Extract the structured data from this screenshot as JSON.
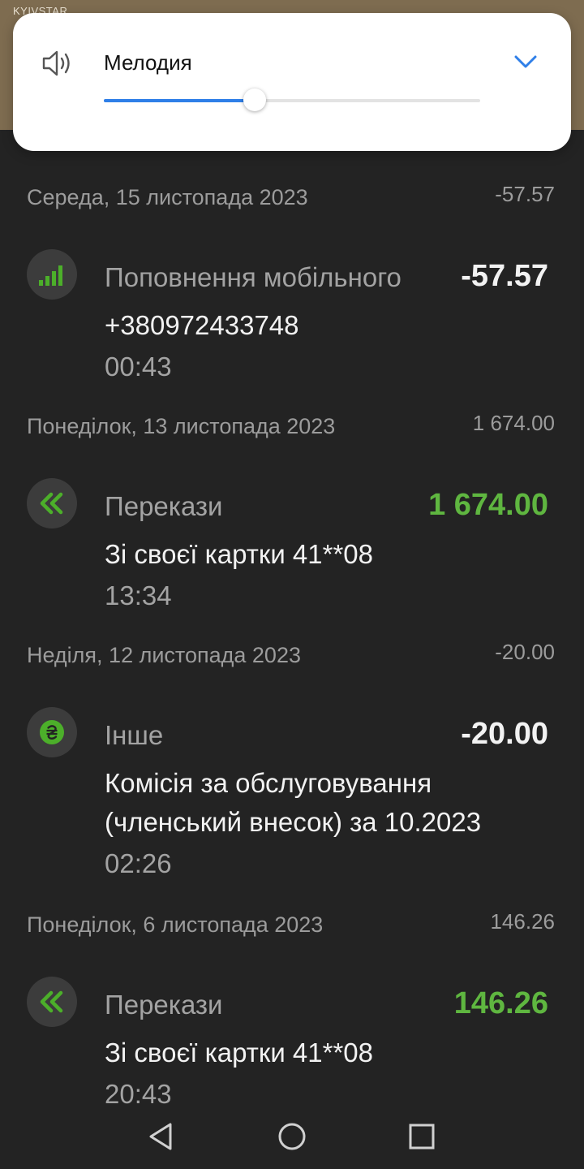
{
  "status_bar": {
    "carrier": "KYIVSTAR"
  },
  "volume": {
    "label": "Мелодия",
    "level": 0.4,
    "accent": "#2f7fe8",
    "icons": {
      "speaker": "speaker-icon",
      "expand": "chevron-down-icon"
    }
  },
  "groups": [
    {
      "date": "Середа, 15 листопада 2023",
      "total": "-57.57",
      "items": [
        {
          "icon": "mobile-signal-icon",
          "category": "Поповнення мобільного",
          "amount": "-57.57",
          "positive": false,
          "description": "+380972433748",
          "time": "00:43"
        }
      ]
    },
    {
      "date": "Понеділок, 13 листопада 2023",
      "total": "1 674.00",
      "items": [
        {
          "icon": "transfer-arrows-icon",
          "category": "Перекази",
          "amount": "1 674.00",
          "positive": true,
          "description": "Зі своєї картки 41**08",
          "time": "13:34"
        }
      ]
    },
    {
      "date": "Неділя, 12 листопада 2023",
      "total": "-20.00",
      "items": [
        {
          "icon": "hryvnia-coin-icon",
          "category": "Інше",
          "amount": "-20.00",
          "positive": false,
          "description": "Комісія за обслуговування (членський внесок) за 10.2023",
          "time": "02:26"
        }
      ]
    },
    {
      "date": "Понеділок, 6 листопада 2023",
      "total": "146.26",
      "items": [
        {
          "icon": "transfer-arrows-icon",
          "category": "Перекази",
          "amount": "146.26",
          "positive": true,
          "description": "Зі своєї картки 41**08",
          "time": "20:43"
        }
      ]
    }
  ],
  "colors": {
    "positive_amount": "#5fb640",
    "icon_green": "#4caf2a"
  },
  "nav": {
    "icons": [
      "back-triangle-icon",
      "home-circle-icon",
      "recents-square-icon"
    ]
  }
}
